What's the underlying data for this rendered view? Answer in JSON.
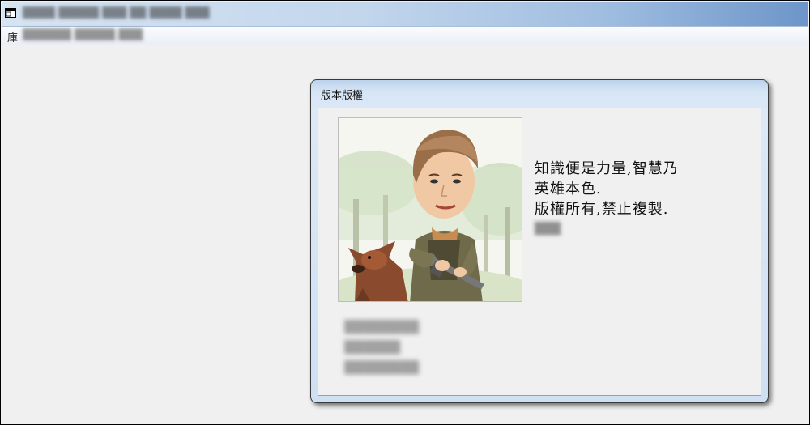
{
  "window": {
    "title": "▒▒▒▒ ▒▒▒▒▒ ▒▒▒ ▒▒ ▒▒▒▒ ▒▒▒"
  },
  "menubar": {
    "first_item": "庫",
    "rest_items": "▒▒▒▒▒▒  ▒▒▒▒▒  ▒▒▒"
  },
  "dialog": {
    "title": "版本版權",
    "quote_lines": [
      "知識便是力量,智慧乃",
      "英雄本色.",
      "版權所有,禁止複製."
    ],
    "author": "▒▒▒",
    "info_lines": [
      "▒▒▒▒▒▒▒▒",
      "▒▒▒▒▒▒",
      "▒▒▒▒▒▒▒▒"
    ]
  }
}
